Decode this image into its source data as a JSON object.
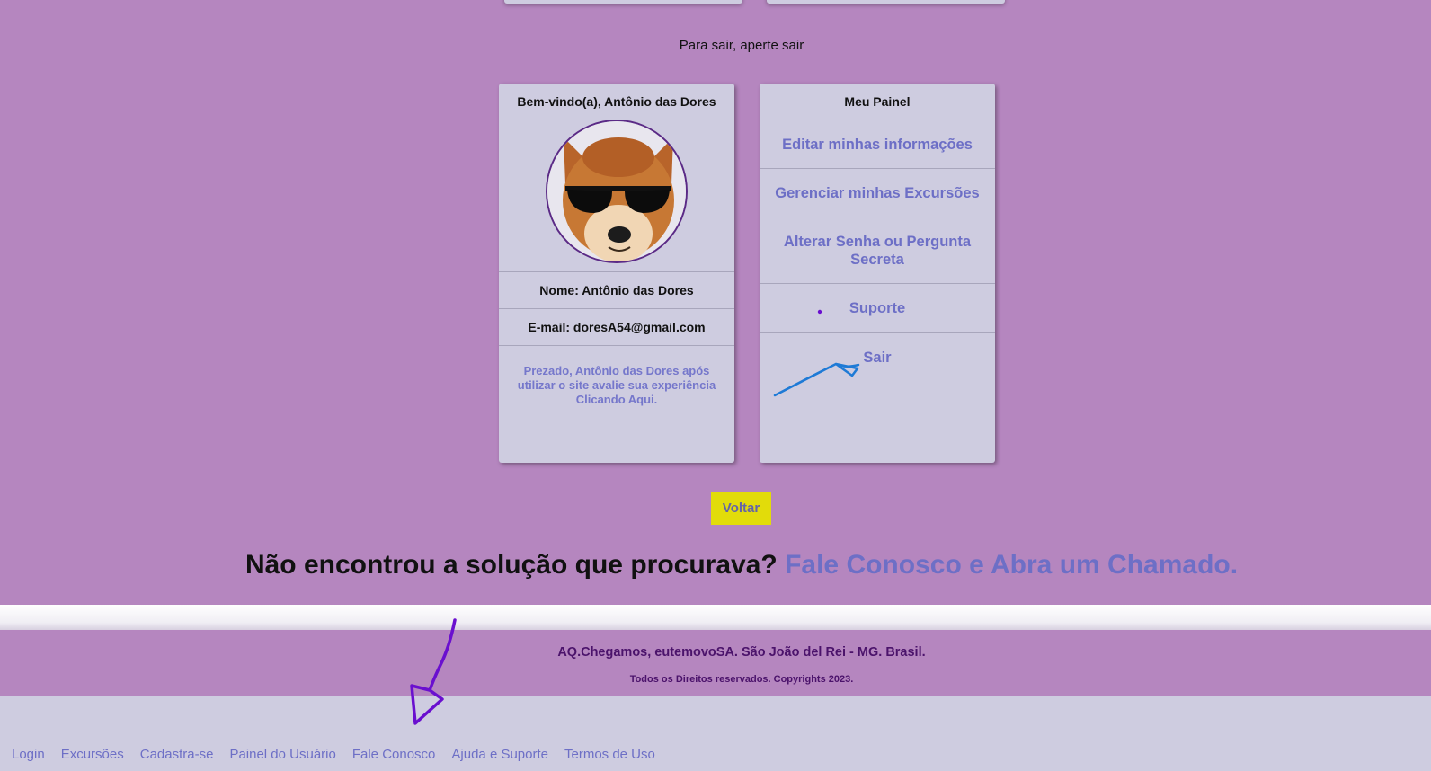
{
  "hint": "Para sair, aperte sair",
  "profile": {
    "welcome": "Bem-vindo(a), Antônio das Dores",
    "name_line": "Nome: Antônio das Dores",
    "email_line": "E-mail: doresA54@gmail.com",
    "feedback_text": "Prezado, Antônio das Dores após utilizar o site avalie sua experiência Clicando Aqui."
  },
  "panel": {
    "title": "Meu Painel",
    "items": [
      {
        "label": "Editar minhas informações"
      },
      {
        "label": "Gerenciar minhas Excursões"
      },
      {
        "label": "Alterar Senha ou Pergunta Secreta"
      },
      {
        "label": "Suporte"
      },
      {
        "label": "Sair"
      }
    ]
  },
  "voltar_label": "Voltar",
  "cta": {
    "question": "Não encontrou a solução que procurava?",
    "link": "Fale Conosco e Abra um Chamado."
  },
  "footer": {
    "line1": "AQ.Chegamos, eutemovoSA. São João del Rei - MG. Brasil.",
    "line2": "Todos os Direitos reservados. Copyrights 2023."
  },
  "nav": [
    "Login",
    "Excursões",
    "Cadastra-se",
    "Painel do Usuário",
    "Fale Conosco",
    "Ajuda e Suporte",
    "Termos de Uso"
  ],
  "colors": {
    "background": "#b586bf",
    "card": "#cecce0",
    "link": "#6d6fc6",
    "button": "#e2dc0a",
    "footer_text": "#4b136b"
  }
}
